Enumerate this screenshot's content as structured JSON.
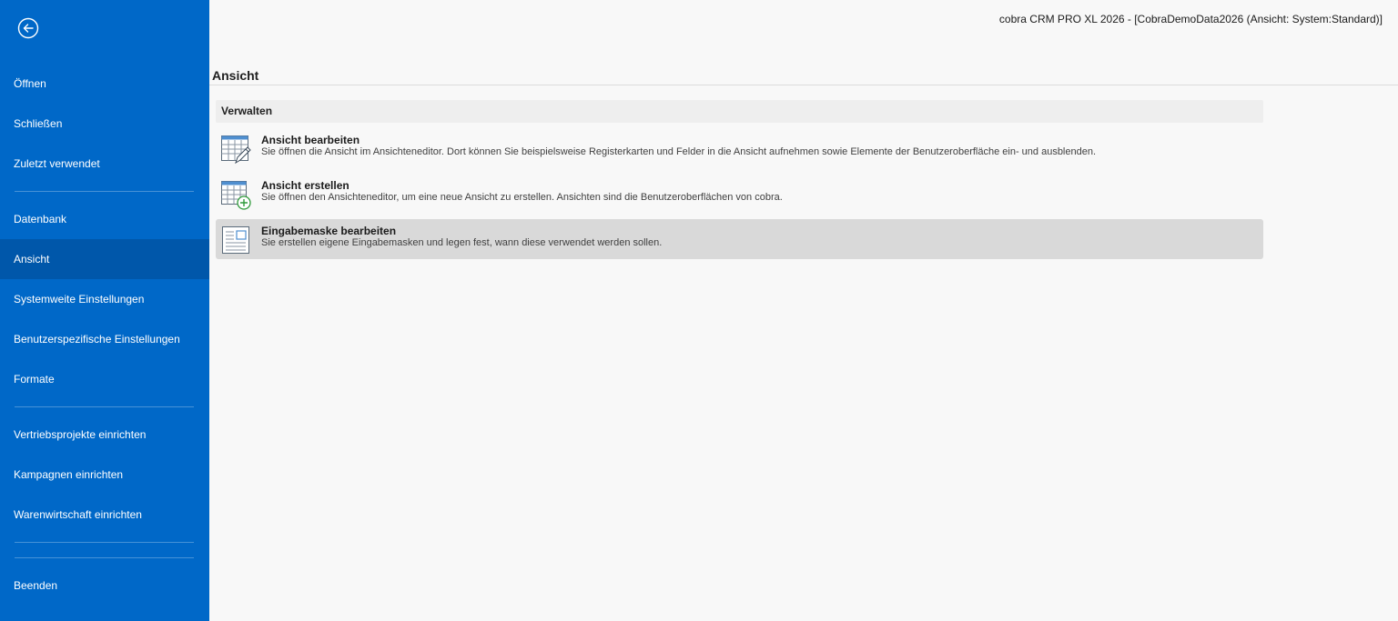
{
  "window": {
    "title": "cobra CRM PRO XL 2026 - [CobraDemoData2026 (Ansicht: System:Standard)]"
  },
  "colors": {
    "sidebar": "#0068c8",
    "sidebar_active": "#0057aa",
    "selected_row": "#d9d9d9"
  },
  "sidebar": {
    "back_icon": "back-arrow-circle-icon",
    "items": [
      {
        "label": "Öffnen"
      },
      {
        "label": "Schließen"
      },
      {
        "label": "Zuletzt verwendet"
      },
      {
        "label": "Datenbank"
      },
      {
        "label": "Ansicht",
        "active": true
      },
      {
        "label": "Systemweite Einstellungen"
      },
      {
        "label": "Benutzerspezifische Einstellungen"
      },
      {
        "label": "Formate"
      },
      {
        "label": "Vertriebsprojekte einrichten"
      },
      {
        "label": "Kampagnen einrichten"
      },
      {
        "label": "Warenwirtschaft einrichten"
      },
      {
        "label": "Beenden"
      }
    ]
  },
  "main": {
    "section_title": "Ansicht",
    "group": {
      "title": "Verwalten",
      "commands": [
        {
          "title": "Ansicht bearbeiten",
          "description": "Sie öffnen die Ansicht im Ansichteneditor. Dort können Sie beispielsweise Registerkarten und Felder in die Ansicht aufnehmen sowie Elemente der Benutzeroberfläche ein- und ausblenden.",
          "icon": "edit-view-icon"
        },
        {
          "title": "Ansicht erstellen",
          "description": "Sie öffnen den Ansichteneditor, um eine neue Ansicht zu erstellen. Ansichten sind die Benutzeroberflächen von cobra.",
          "icon": "create-view-icon"
        },
        {
          "title": "Eingabemaske bearbeiten",
          "description": "Sie erstellen eigene Eingabemasken und legen fest, wann diese verwendet werden sollen.",
          "icon": "input-form-icon",
          "selected": true
        }
      ]
    }
  }
}
